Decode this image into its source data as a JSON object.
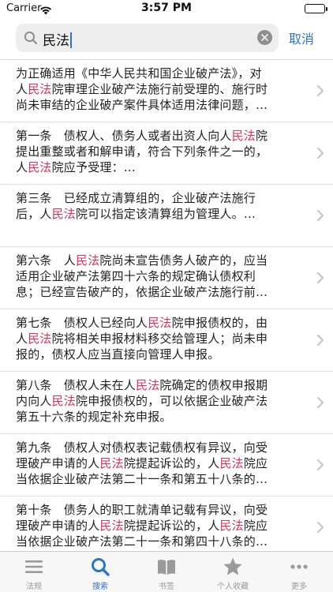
{
  "status_bar": {
    "carrier": "Carrier",
    "time": "3:57 PM"
  },
  "search": {
    "query": "民法",
    "cancel_label": "取消"
  },
  "results": [
    {
      "lines": [
        [
          {
            "t": "为正确适用《中华人民共和国企业破产法》，对"
          }
        ],
        [
          {
            "t": "人"
          },
          {
            "t": "民法",
            "hl": true
          },
          {
            "t": "院审理企业破产法施行前受理的、施行时"
          }
        ],
        [
          {
            "t": "尚未审结的企业破产案件具体适用法律问题，…"
          }
        ]
      ]
    },
    {
      "lines": [
        [
          {
            "t": "第一条　债权人、债务人或者出资人向人"
          },
          {
            "t": "民法",
            "hl": true
          },
          {
            "t": "院"
          }
        ],
        [
          {
            "t": "提出重整或者和解申请，符合下列条件之一的，"
          }
        ],
        [
          {
            "t": "人"
          },
          {
            "t": "民法",
            "hl": true
          },
          {
            "t": "院应予受理：…"
          }
        ]
      ]
    },
    {
      "lines": [
        [
          {
            "t": "第三条　已经成立清算组的，企业破产法施行"
          }
        ],
        [
          {
            "t": "后，人"
          },
          {
            "t": "民法",
            "hl": true
          },
          {
            "t": "院可以指定该清算组为管理人。…"
          }
        ]
      ]
    },
    {
      "lines": [
        [
          {
            "t": "第六条　人"
          },
          {
            "t": "民法",
            "hl": true
          },
          {
            "t": "院尚未宣告债务人破产的，应当"
          }
        ],
        [
          {
            "t": "适用企业破产法第四十六条的规定确认债权利"
          }
        ],
        [
          {
            "t": "息；已经宣告破产的，依据企业破产法施行前…"
          }
        ]
      ]
    },
    {
      "lines": [
        [
          {
            "t": "第七条　债权人已经向人"
          },
          {
            "t": "民法",
            "hl": true
          },
          {
            "t": "院申报债权的，由"
          }
        ],
        [
          {
            "t": "人"
          },
          {
            "t": "民法",
            "hl": true
          },
          {
            "t": "院将相关申报材料移交给管理人；尚未申"
          }
        ],
        [
          {
            "t": "报的，债权人应当直接向管理人申报。"
          }
        ]
      ]
    },
    {
      "lines": [
        [
          {
            "t": "第八条　债权人未在人"
          },
          {
            "t": "民法",
            "hl": true
          },
          {
            "t": "院确定的债权申报期"
          }
        ],
        [
          {
            "t": "内向人"
          },
          {
            "t": "民法",
            "hl": true
          },
          {
            "t": "院申报债权的，可以依据企业破产法"
          }
        ],
        [
          {
            "t": "第五十六条的规定补充申报。"
          }
        ]
      ]
    },
    {
      "lines": [
        [
          {
            "t": "第九条　债权人对债权表记载债权有异议，向受"
          }
        ],
        [
          {
            "t": "理破产申请的人"
          },
          {
            "t": "民法",
            "hl": true
          },
          {
            "t": "院提起诉讼的，人"
          },
          {
            "t": "民法",
            "hl": true
          },
          {
            "t": "院应"
          }
        ],
        [
          {
            "t": "当依据企业破产法第二十一条和第五十八条的…"
          }
        ]
      ]
    },
    {
      "lines": [
        [
          {
            "t": "第十条　债务人的职工就清单记载有异议，向受"
          }
        ],
        [
          {
            "t": "理破产申请的人"
          },
          {
            "t": "民法",
            "hl": true
          },
          {
            "t": "院提起诉讼的，人"
          },
          {
            "t": "民法",
            "hl": true
          },
          {
            "t": "院应"
          }
        ],
        [
          {
            "t": "当依据企业破产法第二十一条和第四十八条的…"
          }
        ]
      ]
    }
  ],
  "tabs": [
    {
      "label": "法规",
      "icon": "list-icon"
    },
    {
      "label": "搜索",
      "icon": "search-icon",
      "active": true
    },
    {
      "label": "书签",
      "icon": "book-icon"
    },
    {
      "label": "个人收藏",
      "icon": "star-icon"
    },
    {
      "label": "更多",
      "icon": "more-icon"
    }
  ],
  "colors": {
    "accent": "#2f74c9",
    "highlight": "#d9325e",
    "tab_inactive": "#9a9a9a"
  }
}
